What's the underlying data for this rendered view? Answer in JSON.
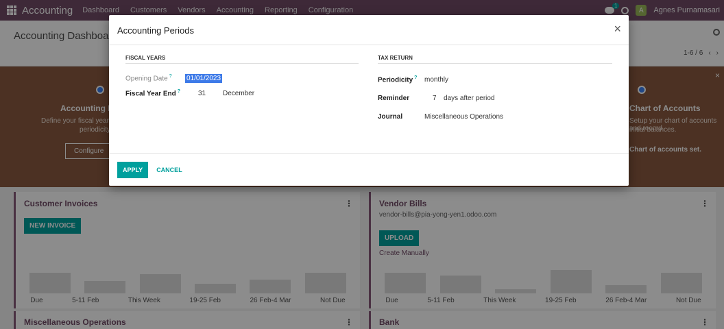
{
  "navbar": {
    "brand": "Accounting",
    "menu": [
      "Dashboard",
      "Customers",
      "Vendors",
      "Accounting",
      "Reporting",
      "Configuration"
    ],
    "chat_badge": "1",
    "avatar_initial": "A",
    "username": "Agnes Purnamasari"
  },
  "control_panel": {
    "title": "Accounting Dashboard",
    "pager": "1-6 / 6",
    "prev": "‹",
    "next": "›"
  },
  "banner": {
    "left_title": "Accounting Periods",
    "left_text_1": "Define your fiscal years & tax returns",
    "left_text_2": "periodicity.",
    "left_button": "Configure",
    "right_title": "Chart of Accounts",
    "right_text_1": "Setup your chart of accounts and record",
    "right_text_2": "initial balances.",
    "right_done": "Chart of accounts set."
  },
  "cards": {
    "customer_invoices": {
      "title": "Customer Invoices",
      "button": "NEW INVOICE",
      "labels": [
        "Due",
        "5-11 Feb",
        "This Week",
        "19-25 Feb",
        "26 Feb-4 Mar",
        "Not Due"
      ]
    },
    "vendor_bills": {
      "title": "Vendor Bills",
      "email": "vendor-bills@pia-yong-yen1.odoo.com",
      "button": "UPLOAD",
      "link": "Create Manually",
      "labels": [
        "Due",
        "5-11 Feb",
        "This Week",
        "19-25 Feb",
        "26 Feb-4 Mar",
        "Not Due"
      ]
    },
    "misc": {
      "title": "Miscellaneous Operations"
    },
    "bank": {
      "title": "Bank"
    }
  },
  "modal": {
    "title": "Accounting Periods",
    "close": "×",
    "fiscal": {
      "section": "FISCAL YEARS",
      "opening_label": "Opening Date",
      "opening_value": "01/01/2023",
      "year_end_label": "Fiscal Year End",
      "year_end_day": "31",
      "year_end_month": "December"
    },
    "tax": {
      "section": "TAX RETURN",
      "periodicity_label": "Periodicity",
      "periodicity_value": "monthly",
      "reminder_label": "Reminder",
      "reminder_days": "7",
      "reminder_suffix": "days after period",
      "journal_label": "Journal",
      "journal_value": "Miscellaneous Operations"
    },
    "help_mark": "?",
    "apply": "APPLY",
    "cancel": "CANCEL"
  }
}
